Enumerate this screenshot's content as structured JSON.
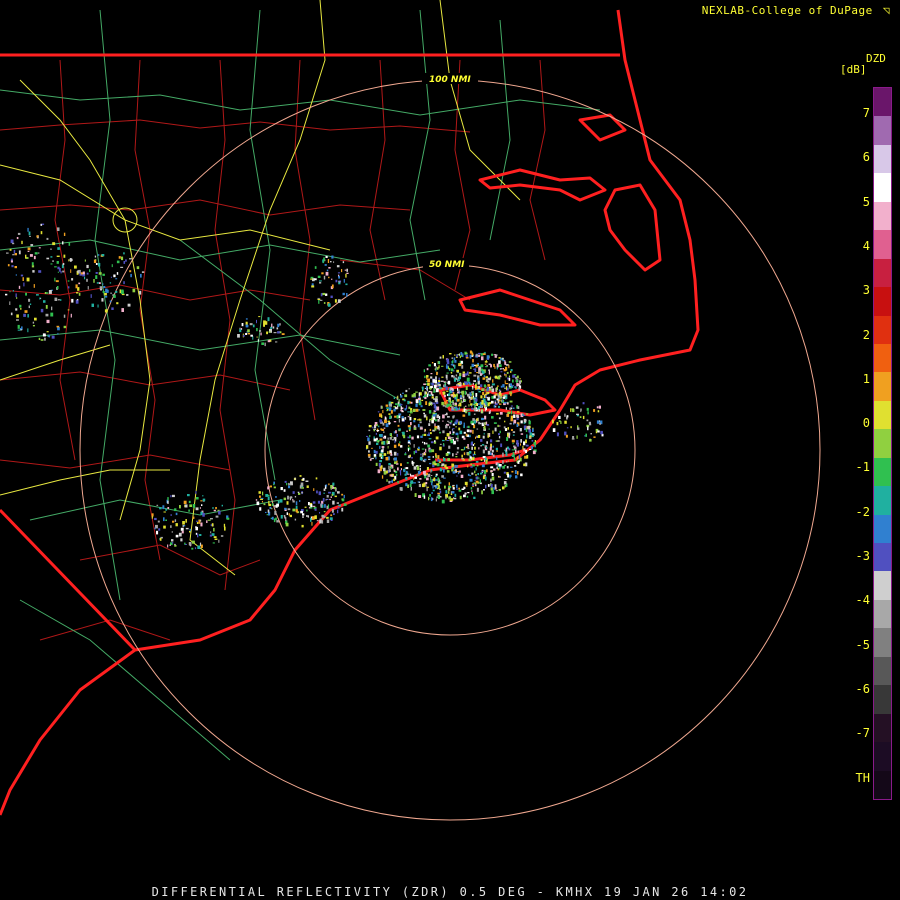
{
  "header": {
    "brand": "NEXLAB-College of DuPage",
    "brand_logo": "nexlab-logo-icon"
  },
  "colorbar": {
    "product": "DZD",
    "unit": "[dB]",
    "ticks": [
      "7",
      "6",
      "5",
      "4",
      "3",
      "2",
      "1",
      "0",
      "-1",
      "-2",
      "-3",
      "-4",
      "-5",
      "-6",
      "-7",
      "TH"
    ],
    "palette": [
      "#6a166a",
      "#a06ab0",
      "#d8c8e8",
      "#ffffff",
      "#f2b0cc",
      "#e06090",
      "#c82040",
      "#c81010",
      "#e03010",
      "#f06010",
      "#f0a020",
      "#e0e030",
      "#90d040",
      "#30c050",
      "#20b0a0",
      "#3080d0",
      "#5050c0",
      "#cfcfcf",
      "#a8a8a8",
      "#808080",
      "#585858",
      "#383838",
      "#241024",
      "#1c0c24",
      "#140818"
    ]
  },
  "range_rings": [
    "100 NMI",
    "50 NMI"
  ],
  "footer": {
    "caption": "DIFFERENTIAL REFLECTIVITY (ZDR) 0.5 DEG - KMHX 19 JAN 26 14:02"
  },
  "colors": {
    "state_border": "#ff2020",
    "county_line": "#b01818",
    "highway": "#e8e840",
    "road": "#44aa66",
    "range_ring": "#f0a890",
    "text": "#ffff33"
  }
}
